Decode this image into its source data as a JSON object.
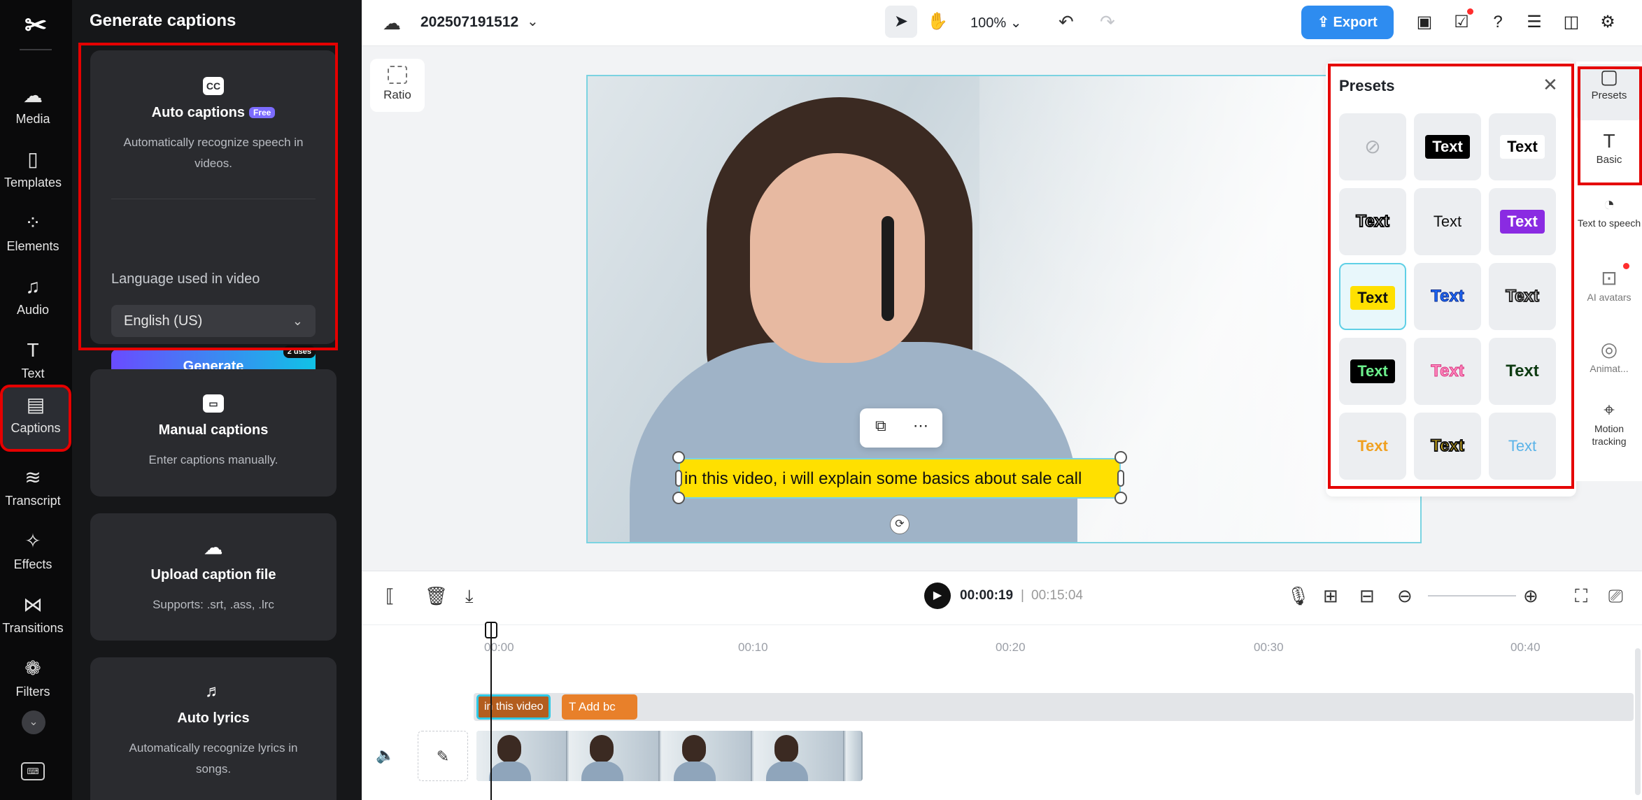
{
  "leftnav": {
    "items": [
      {
        "label": "Media",
        "icon": "cloud-upload-icon"
      },
      {
        "label": "Templates",
        "icon": "templates-icon"
      },
      {
        "label": "Elements",
        "icon": "elements-icon"
      },
      {
        "label": "Audio",
        "icon": "music-note-icon"
      },
      {
        "label": "Text",
        "icon": "text-icon"
      },
      {
        "label": "Captions",
        "icon": "captions-icon"
      },
      {
        "label": "Transcript",
        "icon": "transcript-icon"
      },
      {
        "label": "Effects",
        "icon": "effects-icon"
      },
      {
        "label": "Transitions",
        "icon": "transitions-icon"
      },
      {
        "label": "Filters",
        "icon": "filters-icon"
      }
    ],
    "active": "Captions"
  },
  "panel": {
    "title": "Generate captions",
    "auto": {
      "title": "Auto captions",
      "badge": "Free",
      "description": "Automatically recognize speech in videos.",
      "language_label": "Language used in video",
      "language_value": "English (US)",
      "generate_label": "Generate",
      "uses_badge": "2 uses"
    },
    "manual": {
      "title": "Manual captions",
      "description": "Enter captions manually."
    },
    "upload": {
      "title": "Upload caption file",
      "description": "Supports: .srt, .ass, .lrc"
    },
    "lyrics": {
      "title": "Auto lyrics",
      "description": "Automatically recognize lyrics in songs."
    }
  },
  "topbar": {
    "project_name": "202507191512",
    "zoom": "100%",
    "export_label": "Export"
  },
  "canvas": {
    "ratio_label": "Ratio",
    "caption_text": "in this video, i will explain some basics about sale call"
  },
  "presets": {
    "title": "Presets",
    "sample": "Text",
    "items": [
      {
        "style": "none",
        "label": ""
      },
      {
        "style": "white-on-black",
        "label": "Text"
      },
      {
        "style": "black-on-white",
        "label": "Text"
      },
      {
        "style": "white-outline-black",
        "label": "Text"
      },
      {
        "style": "plain-black",
        "label": "Text"
      },
      {
        "style": "white-on-purple",
        "label": "Text"
      },
      {
        "style": "black-on-yellow",
        "label": "Text"
      },
      {
        "style": "blue-outline",
        "label": "Text"
      },
      {
        "style": "black-outline-white",
        "label": "Text"
      },
      {
        "style": "green-on-black",
        "label": "Text"
      },
      {
        "style": "pink-outline",
        "label": "Text"
      },
      {
        "style": "dark-green",
        "label": "Text"
      },
      {
        "style": "orange-gradient",
        "label": "Text"
      },
      {
        "style": "yellow-black-outline",
        "label": "Text"
      },
      {
        "style": "light-blue",
        "label": "Text"
      }
    ],
    "selected_index": 6
  },
  "rail": {
    "items": [
      {
        "label": "Presets"
      },
      {
        "label": "Basic"
      },
      {
        "label": "Text to speech"
      },
      {
        "label": "AI avatars"
      },
      {
        "label": "Animat..."
      },
      {
        "label": "Motion tracking"
      }
    ]
  },
  "timeline": {
    "current_time": "00:00:19",
    "separator": "|",
    "total_time": "00:15:04",
    "ticks": [
      "00:00",
      "00:10",
      "00:20",
      "00:30",
      "00:40"
    ],
    "caption_clip": "in this video",
    "add_clip": "Add bc"
  }
}
